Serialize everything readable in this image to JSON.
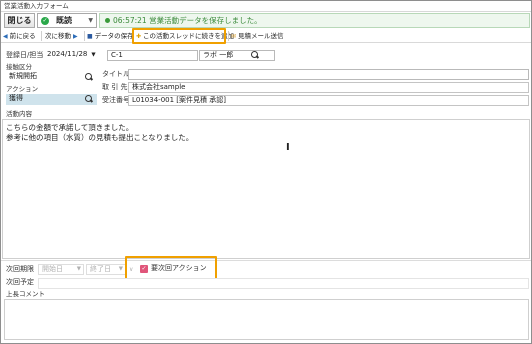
{
  "window": {
    "title": "営業活動入力フォーム"
  },
  "header": {
    "close_label": "閉じる",
    "status_value": "既読",
    "toast_text": "06:57:21 営業活動データを保存しました。"
  },
  "toolbar": {
    "prev_label": "前に戻る",
    "next_label": "次に移動",
    "save_label": "データの保存",
    "add_thread_label": "この活動スレッドに続きを追加",
    "mail_label": "見積メール送信"
  },
  "form": {
    "date_label": "登録日/担当",
    "date_value": "2024/11/28",
    "person_code": "C-1",
    "person_name": "ラボ 一郎",
    "contact_type_label": "接触区分",
    "contact_type_value": "新規開拓",
    "action_label": "アクション",
    "action_value": "獲得",
    "title_label": "タイトル",
    "title_value": "",
    "client_label": "取 引 先",
    "client_value": "株式会社sample",
    "order_label": "受注番号",
    "order_value": "L01034-001 [案件見積 承認]"
  },
  "memo": {
    "label": "活動内容",
    "line1": "こちらの金額で承諾して頂きました。",
    "line2": "参考に他の項目（水質）の見積も提出ことなりました。"
  },
  "next_action": {
    "period_label": "次回期限",
    "start_placeholder": "開始日",
    "end_placeholder": "終了日",
    "important_label": "要次回アクション",
    "plan_label": "次回予定",
    "comment_label": "上長コメント"
  }
}
